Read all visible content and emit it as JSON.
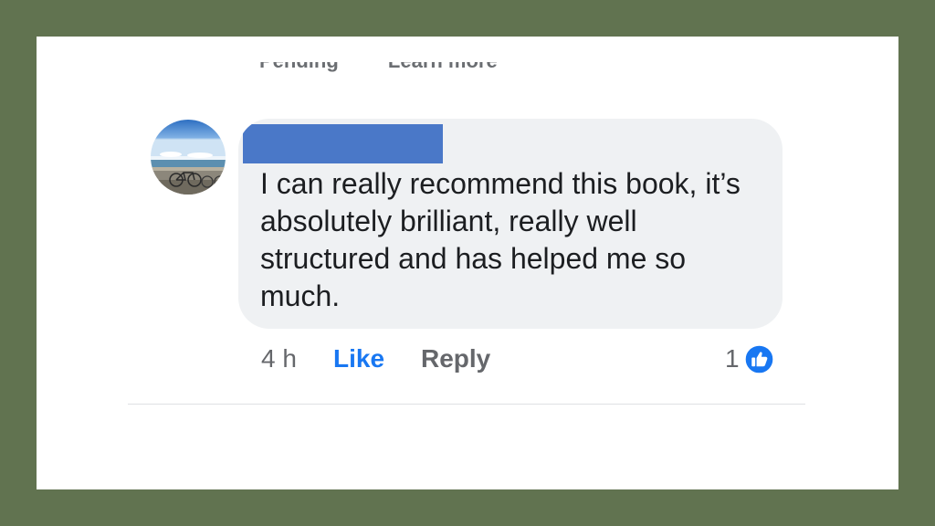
{
  "previous_comment": {
    "left_action": "Pending",
    "right_action": "Learn more"
  },
  "comment": {
    "text": "I can really recommend this book, it’s absolutely brilliant, really well structured and has helped me so much."
  },
  "actions": {
    "time": "4 h",
    "like": "Like",
    "reply": "Reply",
    "reaction_count": "1",
    "reaction_icon": "thumbs-up-icon"
  },
  "colors": {
    "frame": "#617350",
    "bubble": "#eff1f3",
    "like_blue": "#1877f2",
    "redaction": "#4a78c8"
  }
}
